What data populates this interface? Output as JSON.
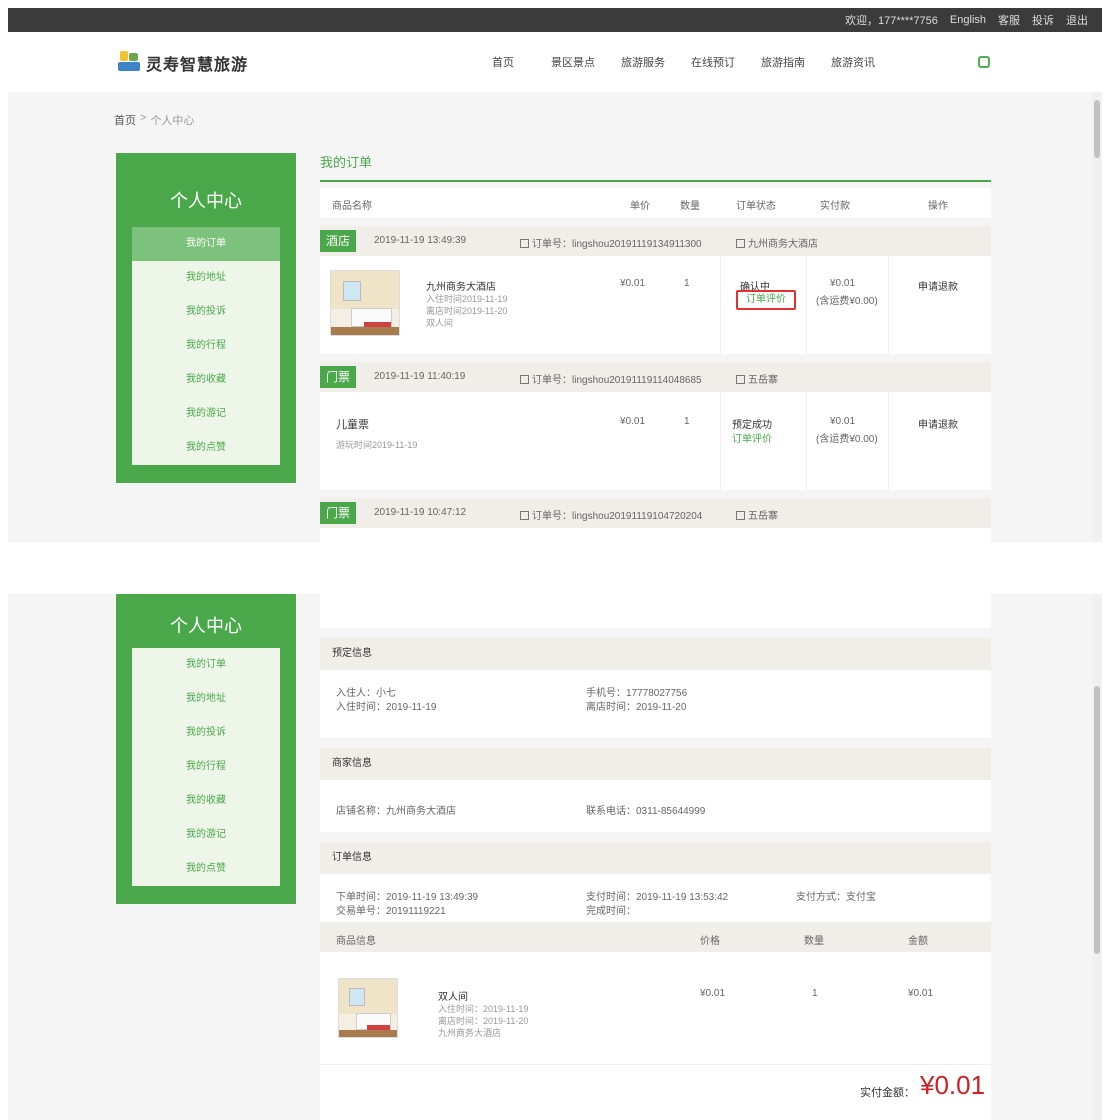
{
  "topbar": {
    "welcome": "欢迎，177****7756",
    "english": "English",
    "links": [
      "客服",
      "投诉",
      "退出"
    ]
  },
  "header": {
    "logo_text": "灵寿智慧旅游",
    "nav": [
      "首页",
      "景区景点",
      "旅游服务",
      "在线预订",
      "旅游指南",
      "旅游资讯"
    ]
  },
  "breadcrumb": {
    "home": "首页",
    "separator": ">",
    "current": "个人中心"
  },
  "sidebar": {
    "title": "个人中心",
    "items": [
      "我的订单",
      "我的地址",
      "我的投诉",
      "我的行程",
      "我的收藏",
      "我的游记",
      "我的点赞"
    ],
    "active_index": 0
  },
  "orders_section": {
    "title": "我的订单",
    "columns": [
      "商品名称",
      "单价",
      "数量",
      "订单状态",
      "实付款",
      "操作"
    ]
  },
  "orders": [
    {
      "type": "酒店",
      "datetime": "2019-11-19 13:49:39",
      "order_no": "订单号：lingshou20191119134911300",
      "shop": "九州商务大酒店",
      "item_name": "九州商务大酒店",
      "details": [
        "入住时间2019-11-19",
        "离店时间2019-11-20",
        "双人间"
      ],
      "price": "¥0.01",
      "qty": "1",
      "status": "确认中",
      "review": "订单评价",
      "paid": "¥0.01",
      "paid_note": "(含运费¥0.00)",
      "action": "申请退款"
    },
    {
      "type": "门票",
      "datetime": "2019-11-19 11:40:19",
      "order_no": "订单号：lingshou20191119114048685",
      "shop": "五岳寨",
      "item_name": "儿童票",
      "details": [
        "游玩时间2019-11-19"
      ],
      "price": "¥0.01",
      "qty": "1",
      "status": "预定成功",
      "review": "订单评价",
      "paid": "¥0.01",
      "paid_note": "(含运费¥0.00)",
      "action": "申请退款"
    },
    {
      "type": "门票",
      "datetime": "2019-11-19 10:47:12",
      "order_no": "订单号：lingshou20191119104720204",
      "shop": "五岳寨"
    }
  ],
  "booking_info": {
    "title": "预定信息",
    "guest_label": "入住人：小七",
    "checkin_label": "入住时间：2019-11-19",
    "phone_label": "手机号：17778027756",
    "checkout_label": "离店时间：2019-11-20"
  },
  "merchant_info": {
    "title": "商家信息",
    "shop_label": "店铺名称：九州商务大酒店",
    "tel_label": "联系电话：0311-85644999"
  },
  "order_info": {
    "title": "订单信息",
    "order_time": "下单时间：2019-11-19 13:49:39",
    "trade_no": "交易单号：20191119221",
    "pay_time": "支付时间：2019-11-19 13:53:42",
    "finish_time": "完成时间：",
    "pay_method": "支付方式：支付宝",
    "columns": [
      "商品信息",
      "价格",
      "数量",
      "金额"
    ],
    "item_name": "双人间",
    "item_details": [
      "入住时间：2019-11-19",
      "离店时间：2019-11-20",
      "九州商务大酒店"
    ],
    "price": "¥0.01",
    "qty": "1",
    "amount": "¥0.01",
    "total_label": "实付金额：",
    "total_value": "¥0.01"
  }
}
